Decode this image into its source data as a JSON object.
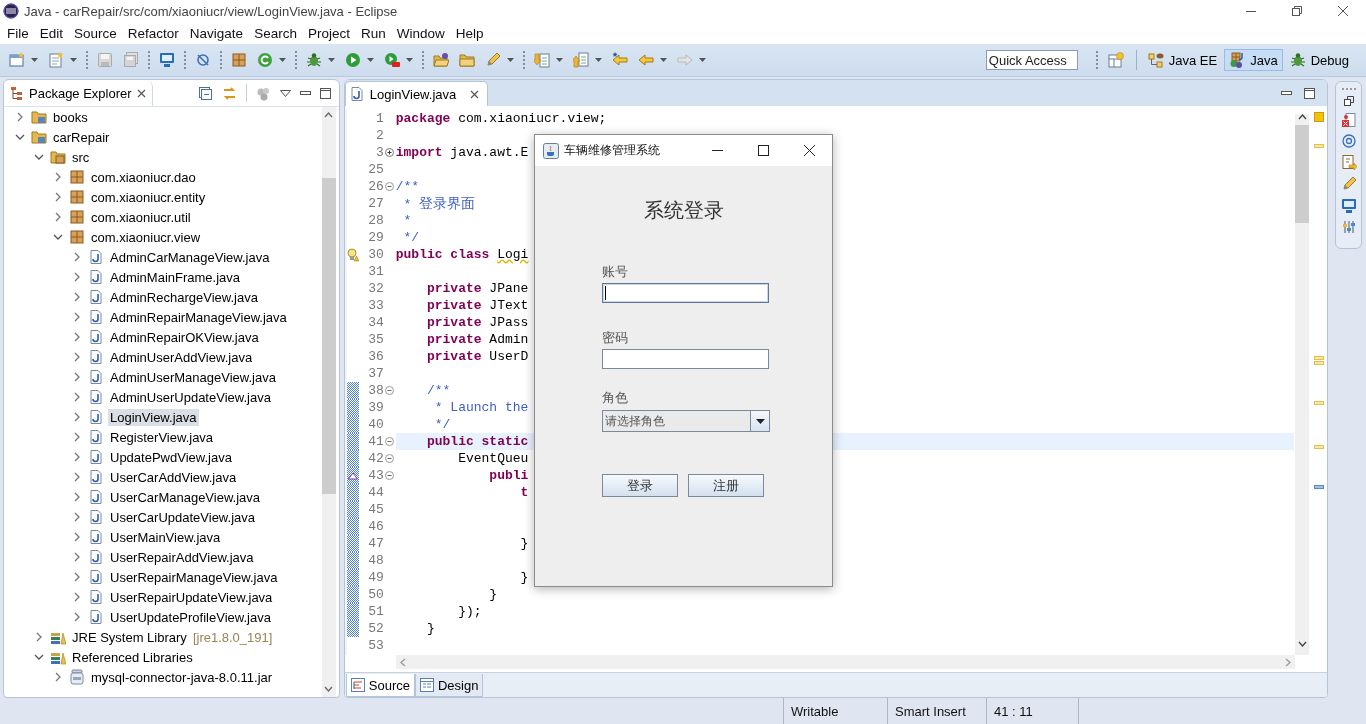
{
  "window": {
    "title": "Java - carRepair/src/com/xiaoniucr/view/LoginView.java - Eclipse"
  },
  "menu": [
    "File",
    "Edit",
    "Source",
    "Refactor",
    "Navigate",
    "Search",
    "Project",
    "Run",
    "Window",
    "Help"
  ],
  "quick_access": {
    "placeholder": "Quick Access"
  },
  "perspectives": [
    {
      "label": "Java EE",
      "kind": "enterprise",
      "selected": false
    },
    {
      "label": "Java",
      "kind": "java",
      "selected": true
    },
    {
      "label": "Debug",
      "kind": "debug",
      "selected": false
    }
  ],
  "package_explorer": {
    "tab": {
      "label": "Package Explorer",
      "selected": true
    },
    "tree": [
      {
        "label": "books",
        "kind": "project",
        "expanded": false,
        "selected": false
      },
      {
        "label": "carRepair",
        "kind": "project",
        "expanded": true,
        "selected": false,
        "children": [
          {
            "label": "src",
            "kind": "source",
            "expanded": true,
            "selected": false,
            "children": [
              {
                "label": "com.xiaoniucr.dao",
                "kind": "package",
                "expanded": false,
                "selected": false
              },
              {
                "label": "com.xiaoniucr.entity",
                "kind": "package",
                "expanded": false,
                "selected": false
              },
              {
                "label": "com.xiaoniucr.util",
                "kind": "package",
                "expanded": false,
                "selected": false
              },
              {
                "label": "com.xiaoniucr.view",
                "kind": "package",
                "expanded": true,
                "selected": false,
                "children": [
                  {
                    "label": "AdminCarManageView.java",
                    "kind": "java",
                    "expanded": false,
                    "selected": false
                  },
                  {
                    "label": "AdminMainFrame.java",
                    "kind": "java",
                    "expanded": false,
                    "selected": false
                  },
                  {
                    "label": "AdminRechargeView.java",
                    "kind": "java",
                    "expanded": false,
                    "selected": false
                  },
                  {
                    "label": "AdminRepairManageView.java",
                    "kind": "java",
                    "expanded": false,
                    "selected": false
                  },
                  {
                    "label": "AdminRepairOKView.java",
                    "kind": "java",
                    "expanded": false,
                    "selected": false
                  },
                  {
                    "label": "AdminUserAddView.java",
                    "kind": "java",
                    "expanded": false,
                    "selected": false
                  },
                  {
                    "label": "AdminUserManageView.java",
                    "kind": "java",
                    "expanded": false,
                    "selected": false
                  },
                  {
                    "label": "AdminUserUpdateView.java",
                    "kind": "java",
                    "expanded": false,
                    "selected": false
                  },
                  {
                    "label": "LoginView.java",
                    "kind": "java",
                    "expanded": false,
                    "selected": true
                  },
                  {
                    "label": "RegisterView.java",
                    "kind": "java",
                    "expanded": false,
                    "selected": false
                  },
                  {
                    "label": "UpdatePwdView.java",
                    "kind": "java",
                    "expanded": false,
                    "selected": false
                  },
                  {
                    "label": "UserCarAddView.java",
                    "kind": "java",
                    "expanded": false,
                    "selected": false
                  },
                  {
                    "label": "UserCarManageView.java",
                    "kind": "java",
                    "expanded": false,
                    "selected": false
                  },
                  {
                    "label": "UserCarUpdateView.java",
                    "kind": "java",
                    "expanded": false,
                    "selected": false
                  },
                  {
                    "label": "UserMainView.java",
                    "kind": "java",
                    "expanded": false,
                    "selected": false
                  },
                  {
                    "label": "UserRepairAddView.java",
                    "kind": "java",
                    "expanded": false,
                    "selected": false
                  },
                  {
                    "label": "UserRepairManageView.java",
                    "kind": "java",
                    "expanded": false,
                    "selected": false
                  },
                  {
                    "label": "UserRepairUpdateView.java",
                    "kind": "java",
                    "expanded": false,
                    "selected": false
                  },
                  {
                    "label": "UserUpdateProfileView.java",
                    "kind": "java",
                    "expanded": false,
                    "selected": false
                  }
                ]
              }
            ]
          },
          {
            "label": "JRE System Library",
            "decoration": "[jre1.8.0_191]",
            "kind": "library",
            "expanded": false,
            "selected": false
          },
          {
            "label": "Referenced Libraries",
            "kind": "library",
            "expanded": true,
            "selected": false,
            "children": [
              {
                "label": "mysql-connector-java-8.0.11.jar",
                "kind": "jar",
                "expanded": false,
                "selected": false
              }
            ]
          }
        ]
      }
    ]
  },
  "editor": {
    "tabs": [
      {
        "label": "LoginView.java",
        "selected": true
      }
    ],
    "lines": [
      {
        "number": "1",
        "current": false,
        "changed": false,
        "tokens": [
          {
            "kind": "keyword",
            "text": "package"
          },
          {
            "kind": "plain",
            "text": " com.xiaoniucr.view;"
          }
        ]
      },
      {
        "number": "2",
        "current": false,
        "changed": false
      },
      {
        "number": "3",
        "current": false,
        "changed": false,
        "folded": true,
        "tokens": [
          {
            "kind": "keyword",
            "text": "import"
          },
          {
            "kind": "plain",
            "text": " java.awt.E"
          }
        ]
      },
      {
        "number": "25",
        "current": false,
        "changed": false
      },
      {
        "number": "26",
        "current": false,
        "changed": false,
        "folded": false,
        "tokens": [
          {
            "kind": "comment",
            "text": "/**"
          }
        ]
      },
      {
        "number": "27",
        "current": false,
        "changed": false,
        "tokens": [
          {
            "kind": "comment",
            "text": " * 登录界面"
          }
        ]
      },
      {
        "number": "28",
        "current": false,
        "changed": false,
        "tokens": [
          {
            "kind": "comment",
            "text": " *"
          }
        ]
      },
      {
        "number": "29",
        "current": false,
        "changed": false,
        "tokens": [
          {
            "kind": "comment",
            "text": " */"
          }
        ]
      },
      {
        "number": "30",
        "current": false,
        "changed": false,
        "marker": {
          "kind": "warning"
        },
        "tokens": [
          {
            "kind": "keyword",
            "text": "public class "
          },
          {
            "kind": "flagged",
            "text": "Logi"
          }
        ]
      },
      {
        "number": "31",
        "current": false,
        "changed": false
      },
      {
        "number": "32",
        "current": false,
        "changed": false,
        "tokens": [
          {
            "kind": "keyword",
            "text": "    private"
          },
          {
            "kind": "plain",
            "text": " JPane"
          }
        ]
      },
      {
        "number": "33",
        "current": false,
        "changed": false,
        "tokens": [
          {
            "kind": "keyword",
            "text": "    private"
          },
          {
            "kind": "plain",
            "text": " JText"
          }
        ]
      },
      {
        "number": "34",
        "current": false,
        "changed": false,
        "tokens": [
          {
            "kind": "keyword",
            "text": "    private"
          },
          {
            "kind": "plain",
            "text": " JPass"
          }
        ]
      },
      {
        "number": "35",
        "current": false,
        "changed": false,
        "tokens": [
          {
            "kind": "keyword",
            "text": "    private"
          },
          {
            "kind": "plain",
            "text": " Admin"
          }
        ]
      },
      {
        "number": "36",
        "current": false,
        "changed": false,
        "tokens": [
          {
            "kind": "keyword",
            "text": "    private"
          },
          {
            "kind": "plain",
            "text": " UserD"
          }
        ]
      },
      {
        "number": "37",
        "current": false,
        "changed": false
      },
      {
        "number": "38",
        "current": false,
        "changed": true,
        "folded": false,
        "tokens": [
          {
            "kind": "comment",
            "text": "    /**"
          }
        ]
      },
      {
        "number": "39",
        "current": false,
        "changed": true,
        "tokens": [
          {
            "kind": "comment",
            "text": "     * Launch the"
          }
        ]
      },
      {
        "number": "40",
        "current": false,
        "changed": true,
        "tokens": [
          {
            "kind": "comment",
            "text": "     */"
          }
        ]
      },
      {
        "number": "41",
        "current": true,
        "changed": true,
        "folded": false,
        "tokens": [
          {
            "kind": "keyword",
            "text": "    public static"
          }
        ]
      },
      {
        "number": "42",
        "current": false,
        "changed": true,
        "folded": false,
        "tokens": [
          {
            "kind": "plain",
            "text": "        EventQueu"
          }
        ]
      },
      {
        "number": "43",
        "current": false,
        "changed": true,
        "folded": false,
        "marker": {
          "kind": "override"
        },
        "tokens": [
          {
            "kind": "keyword",
            "text": "            publi"
          }
        ]
      },
      {
        "number": "44",
        "current": false,
        "changed": true,
        "tokens": [
          {
            "kind": "keyword",
            "text": "                t"
          }
        ]
      },
      {
        "number": "45",
        "current": false,
        "changed": true
      },
      {
        "number": "46",
        "current": false,
        "changed": true
      },
      {
        "number": "47",
        "current": false,
        "changed": true,
        "tokens": [
          {
            "kind": "plain",
            "text": "                }"
          }
        ]
      },
      {
        "number": "48",
        "current": false,
        "changed": true
      },
      {
        "number": "49",
        "current": false,
        "changed": true,
        "tokens": [
          {
            "kind": "plain",
            "text": "                }"
          }
        ]
      },
      {
        "number": "50",
        "current": false,
        "changed": true,
        "tokens": [
          {
            "kind": "plain",
            "text": "            }"
          }
        ]
      },
      {
        "number": "51",
        "current": false,
        "changed": true,
        "tokens": [
          {
            "kind": "plain",
            "text": "        });"
          }
        ]
      },
      {
        "number": "52",
        "current": false,
        "changed": true,
        "tokens": [
          {
            "kind": "plain",
            "text": "    }"
          }
        ]
      },
      {
        "number": "53",
        "current": false,
        "changed": false
      }
    ],
    "bottom_tabs": [
      {
        "label": "Source",
        "kind": "source",
        "selected": true
      },
      {
        "label": "Design",
        "kind": "design",
        "selected": false
      }
    ]
  },
  "status_bar": [
    "Writable",
    "Smart Insert",
    "41 : 11"
  ],
  "dialog": {
    "title": "车辆维修管理系统",
    "heading": "系统登录",
    "fields": [
      {
        "label": "账号",
        "kind": "text",
        "focused": true
      },
      {
        "label": "密码",
        "kind": "password",
        "focused": false
      },
      {
        "label": "角色",
        "kind": "select",
        "value": "请选择角色"
      }
    ],
    "buttons": [
      "登录",
      "注册"
    ]
  }
}
